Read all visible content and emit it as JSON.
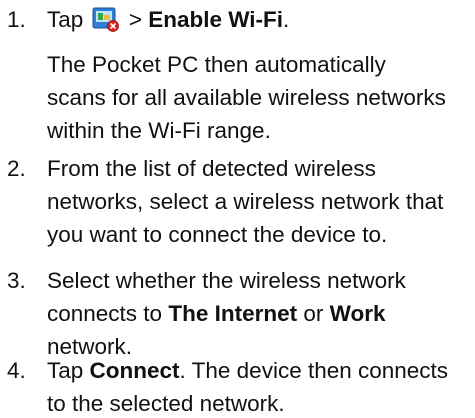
{
  "steps": [
    {
      "number": "1.",
      "prefix": "Tap",
      "separator": ">",
      "bold": "Enable Wi-Fi",
      "suffix": ".",
      "note": [
        "The Pocket PC then automatically",
        "scans for all available wireless networks",
        "within the Wi-Fi range."
      ]
    },
    {
      "number": "2.",
      "lines": [
        "From the list of detected wireless",
        "networks, select a wireless network that",
        "you want to connect the device to."
      ]
    },
    {
      "number": "3.",
      "line1": "Select whether the wireless network",
      "line2_a": "connects to",
      "line2_b1": "The Internet",
      "line2_or": "or",
      "line2_b2": "Work",
      "line3": "network."
    },
    {
      "number": "4.",
      "prefix": "Tap",
      "bold": "Connect",
      "rest": ". The device then connects",
      "line2": "to the selected network."
    }
  ],
  "icon": "wifi-manager-icon"
}
